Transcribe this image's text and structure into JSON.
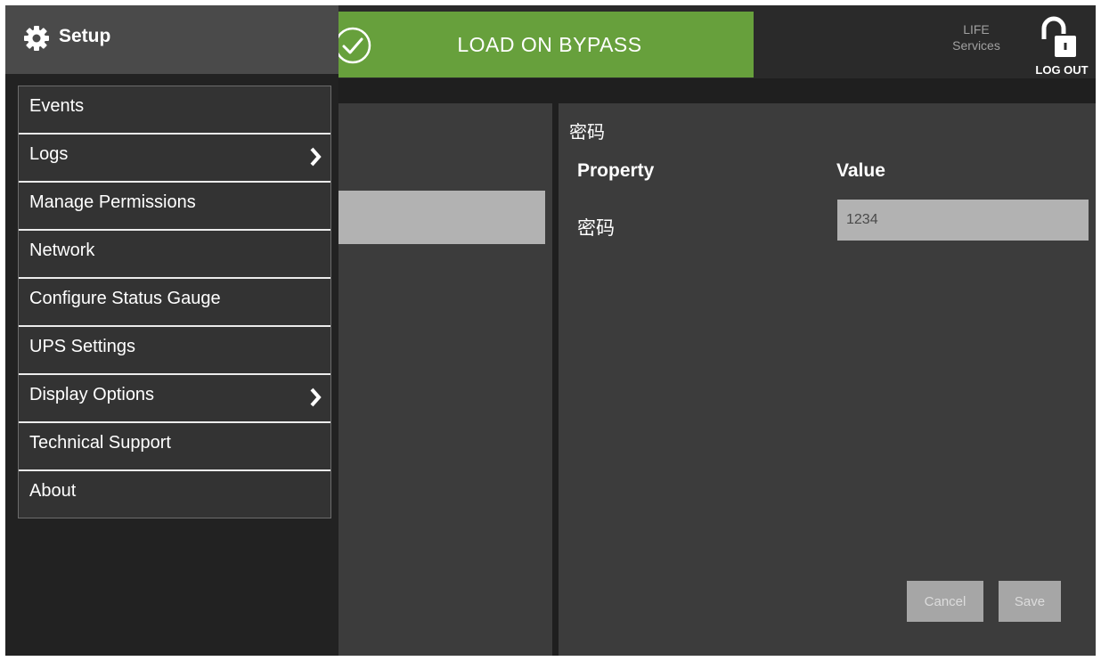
{
  "app": {
    "section_title": "Setup",
    "status_banner": "LOAD ON BYPASS",
    "life_services_line1": "LIFE",
    "life_services_line2": "Services",
    "logout_label": "LOG OUT"
  },
  "sidebar": {
    "items": [
      {
        "label": "Events",
        "has_submenu": false
      },
      {
        "label": "Logs",
        "has_submenu": true
      },
      {
        "label": "Manage Permissions",
        "has_submenu": false
      },
      {
        "label": "Network",
        "has_submenu": false
      },
      {
        "label": "Configure Status Gauge",
        "has_submenu": false
      },
      {
        "label": "UPS Settings",
        "has_submenu": false
      },
      {
        "label": "Display Options",
        "has_submenu": true
      },
      {
        "label": "Technical Support",
        "has_submenu": false
      },
      {
        "label": "About",
        "has_submenu": false
      }
    ]
  },
  "detail": {
    "title": "密码",
    "col_property": "Property",
    "col_value": "Value",
    "property_name": "密码",
    "property_value": "1234",
    "cancel_label": "Cancel",
    "save_label": "Save"
  },
  "colors": {
    "status_ok": "#67a03c",
    "menu_header": "#4a4a4a",
    "panel": "#3c3c3c"
  },
  "icons": {
    "settings": "gear-icon",
    "status": "check-circle-icon",
    "logout": "unlocked-padlock-icon",
    "submenu": "chevron-right-icon"
  }
}
